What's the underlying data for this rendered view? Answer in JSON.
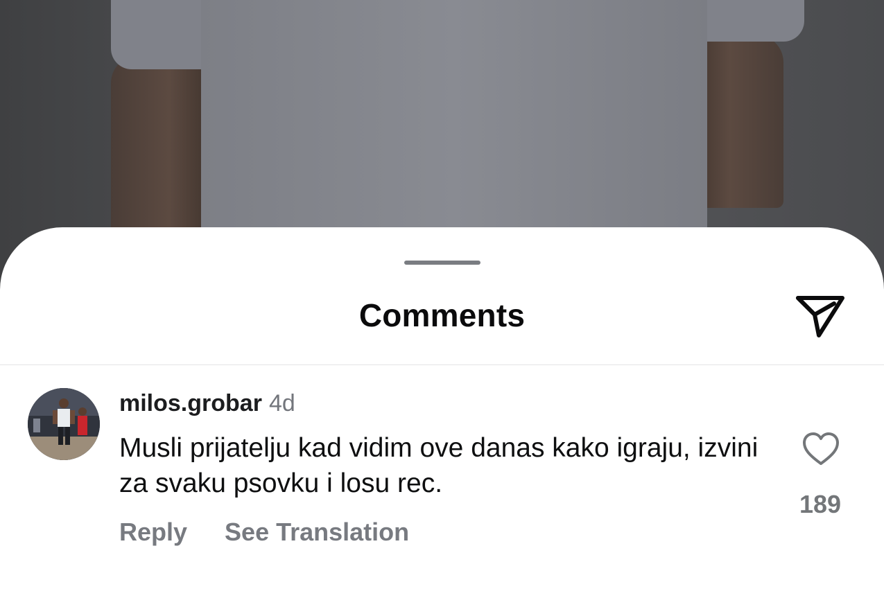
{
  "sheet": {
    "title": "Comments"
  },
  "comment": {
    "username": "milos.grobar",
    "timestamp": "4d",
    "text": "Musli prijatelju kad vidim ove danas kako igraju, izvini za svaku psovku i losu rec.",
    "like_count": "189",
    "reply_label": "Reply",
    "translate_label": "See Translation"
  },
  "icons": {
    "send": "paper-plane-icon",
    "like": "heart-outline-icon"
  },
  "colors": {
    "sheet_background": "#ffffff",
    "secondary_text": "#777a80",
    "primary_text": "#0e0f10"
  }
}
